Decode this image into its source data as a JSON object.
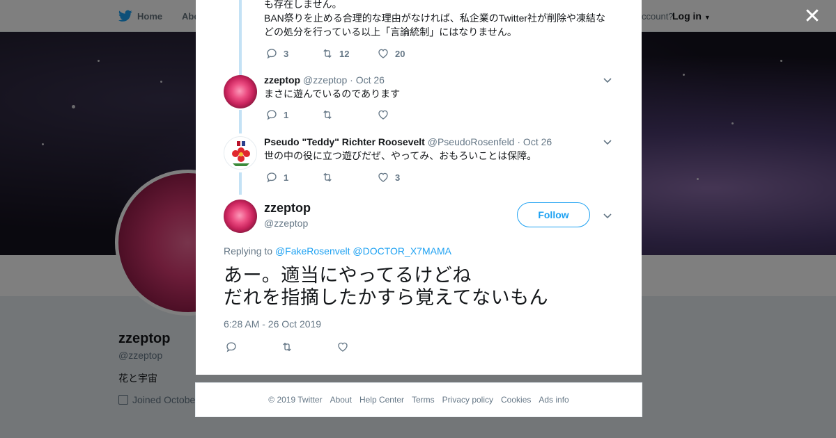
{
  "topbar": {
    "home_label": "Home",
    "about_label": "Abo",
    "account_label": "ccount?",
    "login_label": "Log in"
  },
  "profile": {
    "name": "zzeptop",
    "handle": "@zzeptop",
    "bio": "花と宇宙",
    "joined": "Joined Octobe"
  },
  "thread": {
    "first": {
      "text_lines": [
        "も存在しません。",
        "BAN祭りを止める合理的な理由がなければ、私企業のTwitter社が削除や凍結な",
        "どの処分を行っている以上「言論統制」にはなりません。"
      ],
      "replies": "3",
      "retweets": "12",
      "likes": "20"
    },
    "second": {
      "name": "zzeptop",
      "handle": "@zzeptop",
      "date": "· Oct 26",
      "text": "まさに遊んでいるのであります",
      "replies": "1",
      "retweets": "",
      "likes": ""
    },
    "third": {
      "name": "Pseudo \"Teddy\" Richter Roosevelt",
      "handle": "@PseudoRosenfeld",
      "date": "· Oct 26",
      "text": "世の中の役に立つ遊びだぜ、やってみ、おもろいことは保障。",
      "replies": "1",
      "retweets": "",
      "likes": "3"
    },
    "main": {
      "name": "zzeptop",
      "handle": "@zzeptop",
      "follow_label": "Follow",
      "replying_to_label": "Replying to",
      "mention_1": "@FakeRosenvelt",
      "mention_2": "@DOCTOR_X7MAMA",
      "text_line_1": "あー。適当にやってるけどね",
      "text_line_2": "だれを指摘したかすら覚えてないもん",
      "timestamp": "6:28 AM - 26 Oct 2019"
    }
  },
  "footer": {
    "links": [
      "© 2019 Twitter",
      "About",
      "Help Center",
      "Terms",
      "Privacy policy",
      "Cookies",
      "Ads info"
    ]
  },
  "colors": {
    "accent": "#1da1f2",
    "thread_line": "#c4e2f5",
    "secondary_text": "#657786"
  }
}
